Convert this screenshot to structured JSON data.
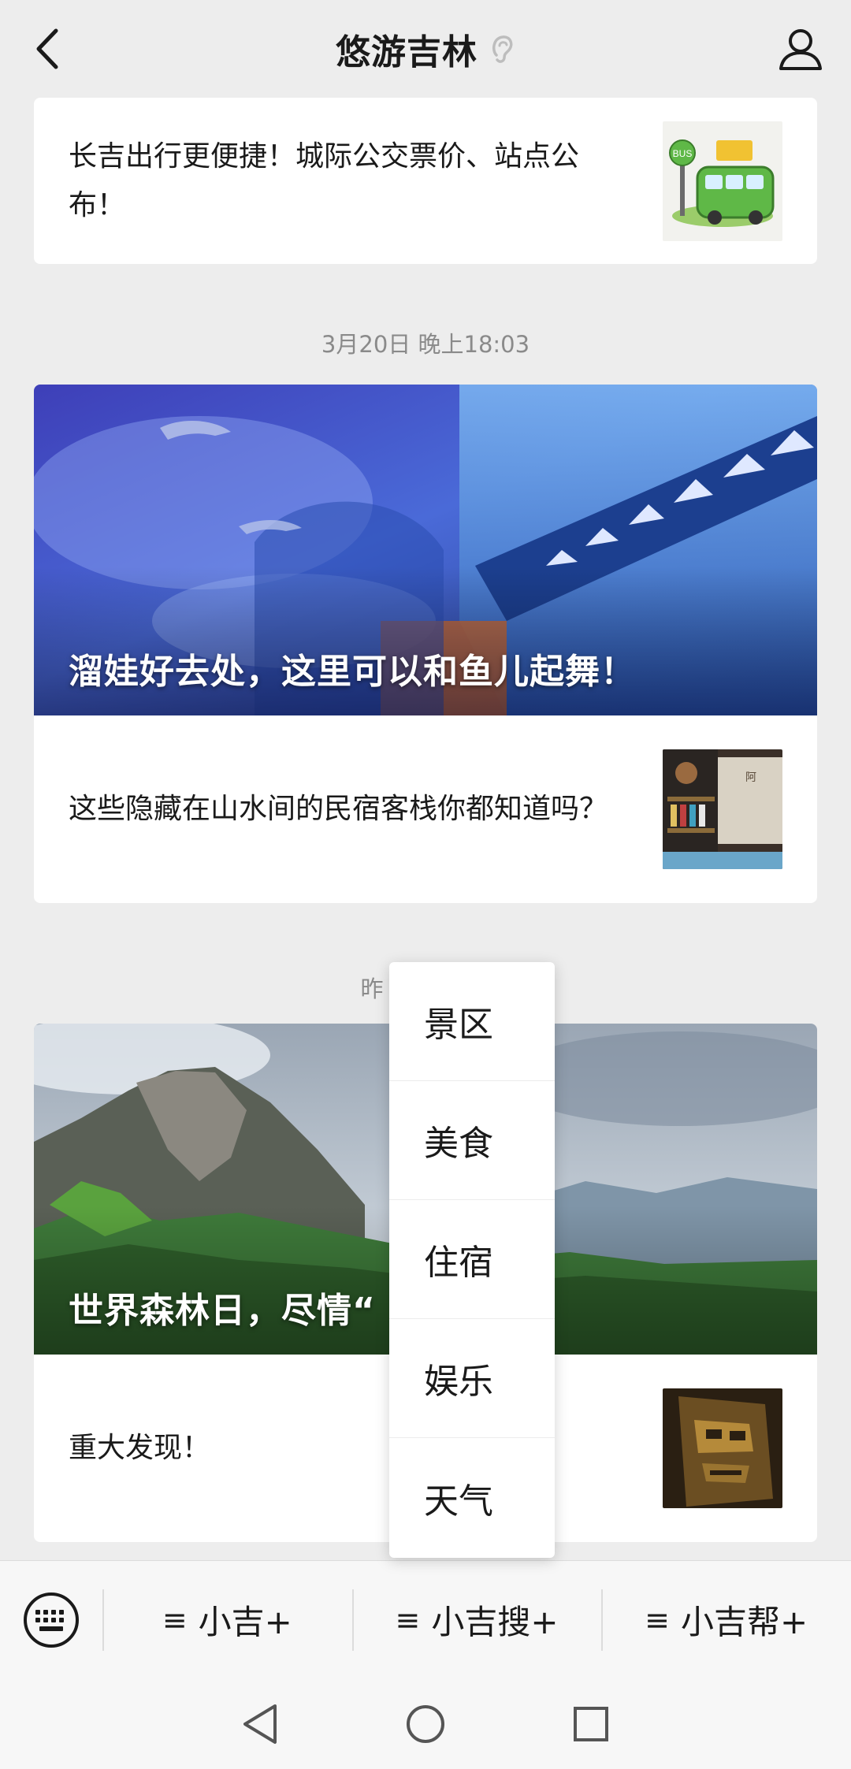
{
  "header": {
    "title": "悠游吉林",
    "back_icon": "chevron-left-icon",
    "profile_icon": "user-icon",
    "ear_icon": "ear-icon"
  },
  "articles": {
    "card1": {
      "text": "长吉出行更便捷！城际公交票价、站点公布！",
      "thumb_icon": "bus-thumbnail"
    },
    "timestamp1": "3月20日 晚上18:03",
    "card2": {
      "cover_title": "溜娃好去处，这里可以和鱼儿起舞！",
      "sub_text": "这些隐藏在山水间的民宿客栈你都知道吗？"
    },
    "timestamp2": "昨",
    "card3": {
      "cover_title": "世界森林日，尽情“",
      "sub_text": "重大发现！"
    }
  },
  "popup_menu": {
    "items": [
      "景区",
      "美食",
      "住宿",
      "娱乐",
      "天气"
    ]
  },
  "bottom_menu": {
    "keyboard_icon": "keyboard-icon",
    "items": [
      {
        "glyph": "≡",
        "label": "小吉+"
      },
      {
        "glyph": "≡",
        "label": "小吉搜+"
      },
      {
        "glyph": "≡",
        "label": "小吉帮+"
      }
    ]
  },
  "nav": {
    "back": "triangle-back-icon",
    "home": "circle-home-icon",
    "recents": "square-recents-icon"
  },
  "colors": {
    "background": "#ededed",
    "card": "#ffffff",
    "bar": "#f7f7f7"
  }
}
